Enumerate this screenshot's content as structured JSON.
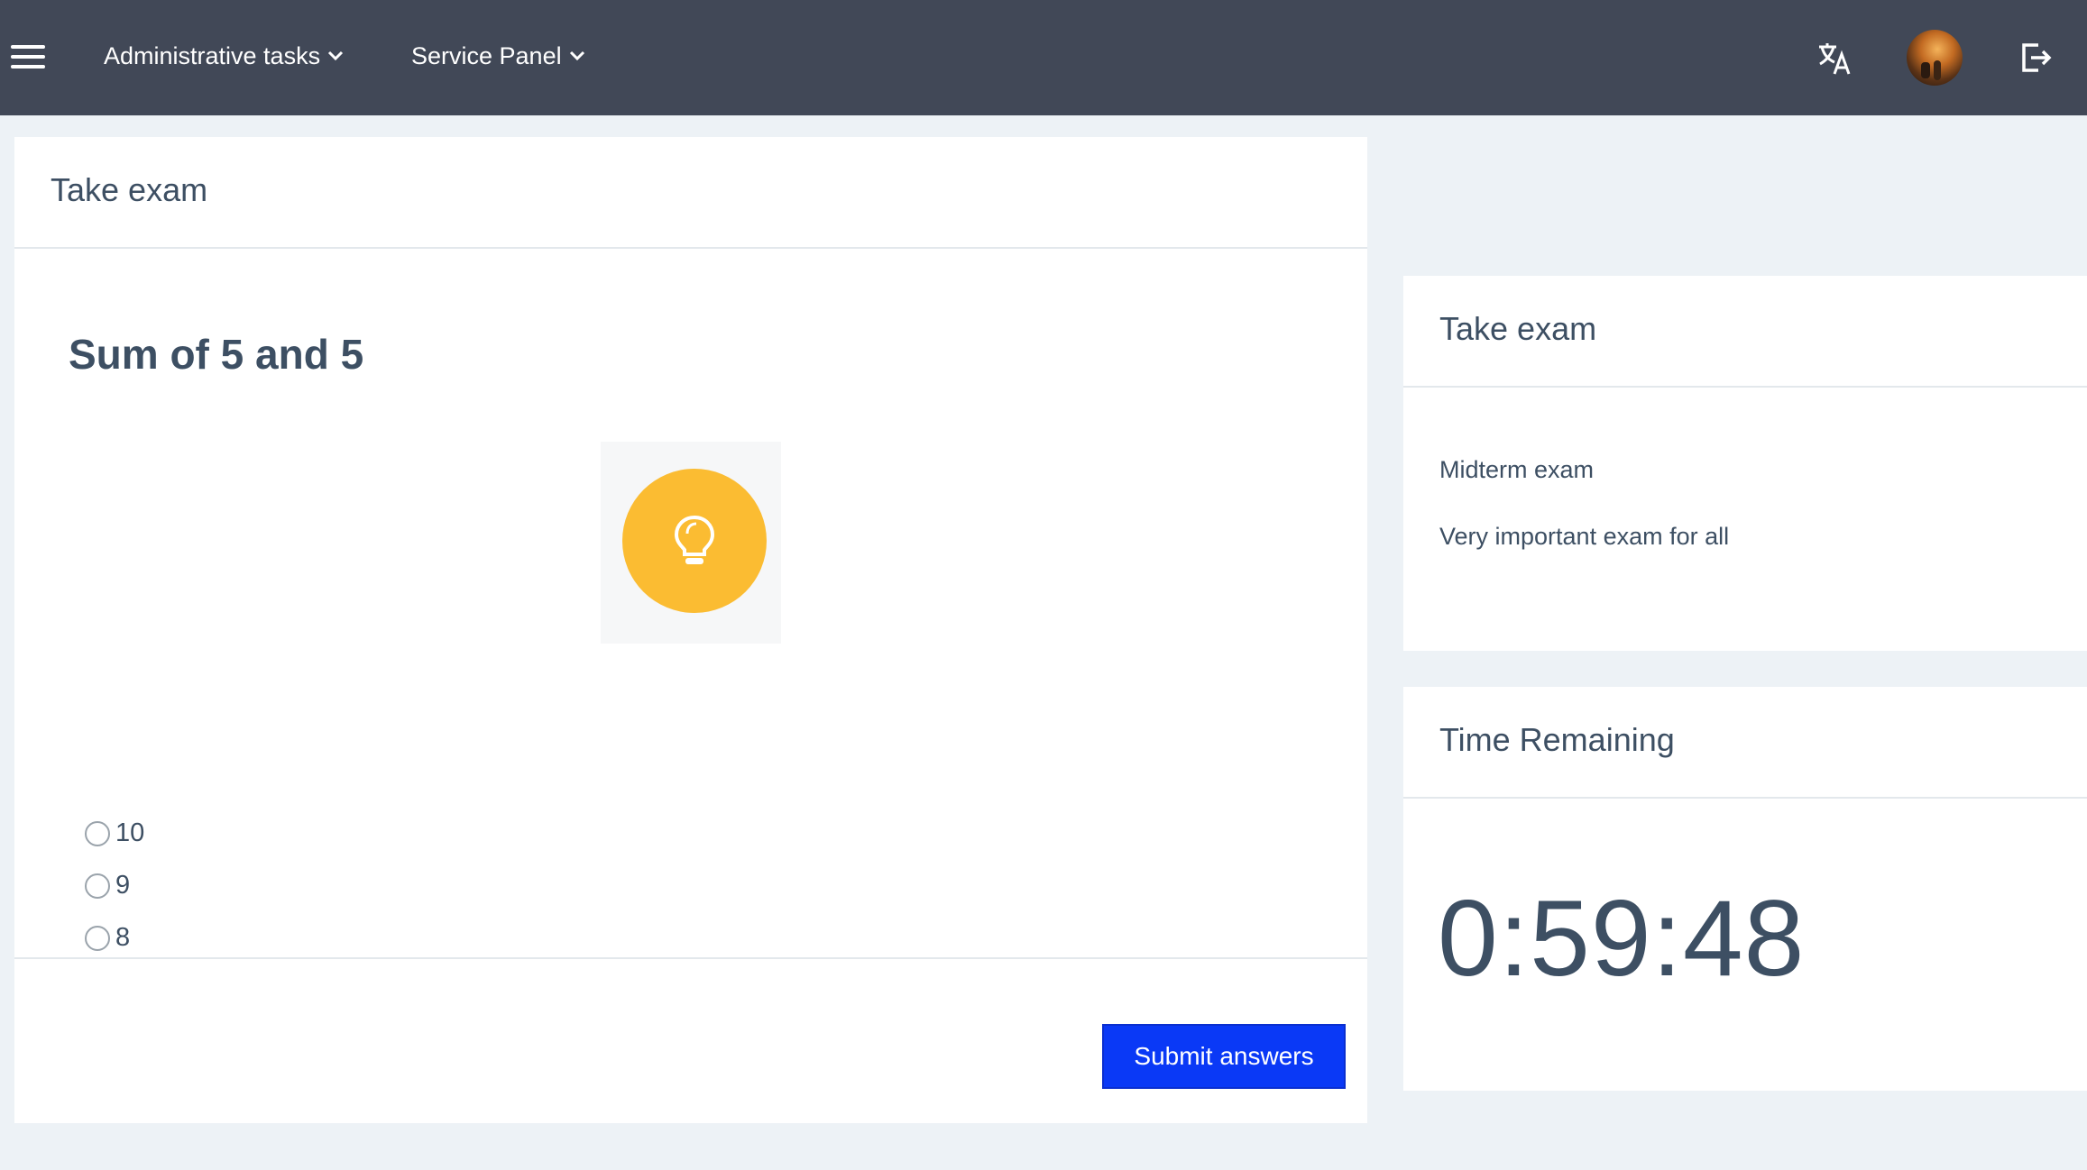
{
  "topbar": {
    "menus": [
      {
        "label": "Administrative tasks"
      },
      {
        "label": "Service Panel"
      }
    ],
    "icons": {
      "menu": "hamburger-menu-icon",
      "translate": "translate-icon",
      "avatar": "user-avatar",
      "logout": "logout-icon"
    }
  },
  "main": {
    "title": "Take exam",
    "question": "Sum of 5 and 5",
    "hint_icon": "lightbulb-icon",
    "options": [
      "10",
      "9",
      "8"
    ],
    "submit_label": "Submit answers"
  },
  "info": {
    "title": "Take exam",
    "exam_name": "Midterm exam",
    "exam_description": "Very important exam for all"
  },
  "timer": {
    "title": "Time Remaining",
    "value": "0:59:48"
  },
  "colors": {
    "topbar": "#414857",
    "background": "#edf2f6",
    "text": "#3d4f63",
    "primary_button": "#0a39f6",
    "hint_circle": "#fbbc32"
  }
}
